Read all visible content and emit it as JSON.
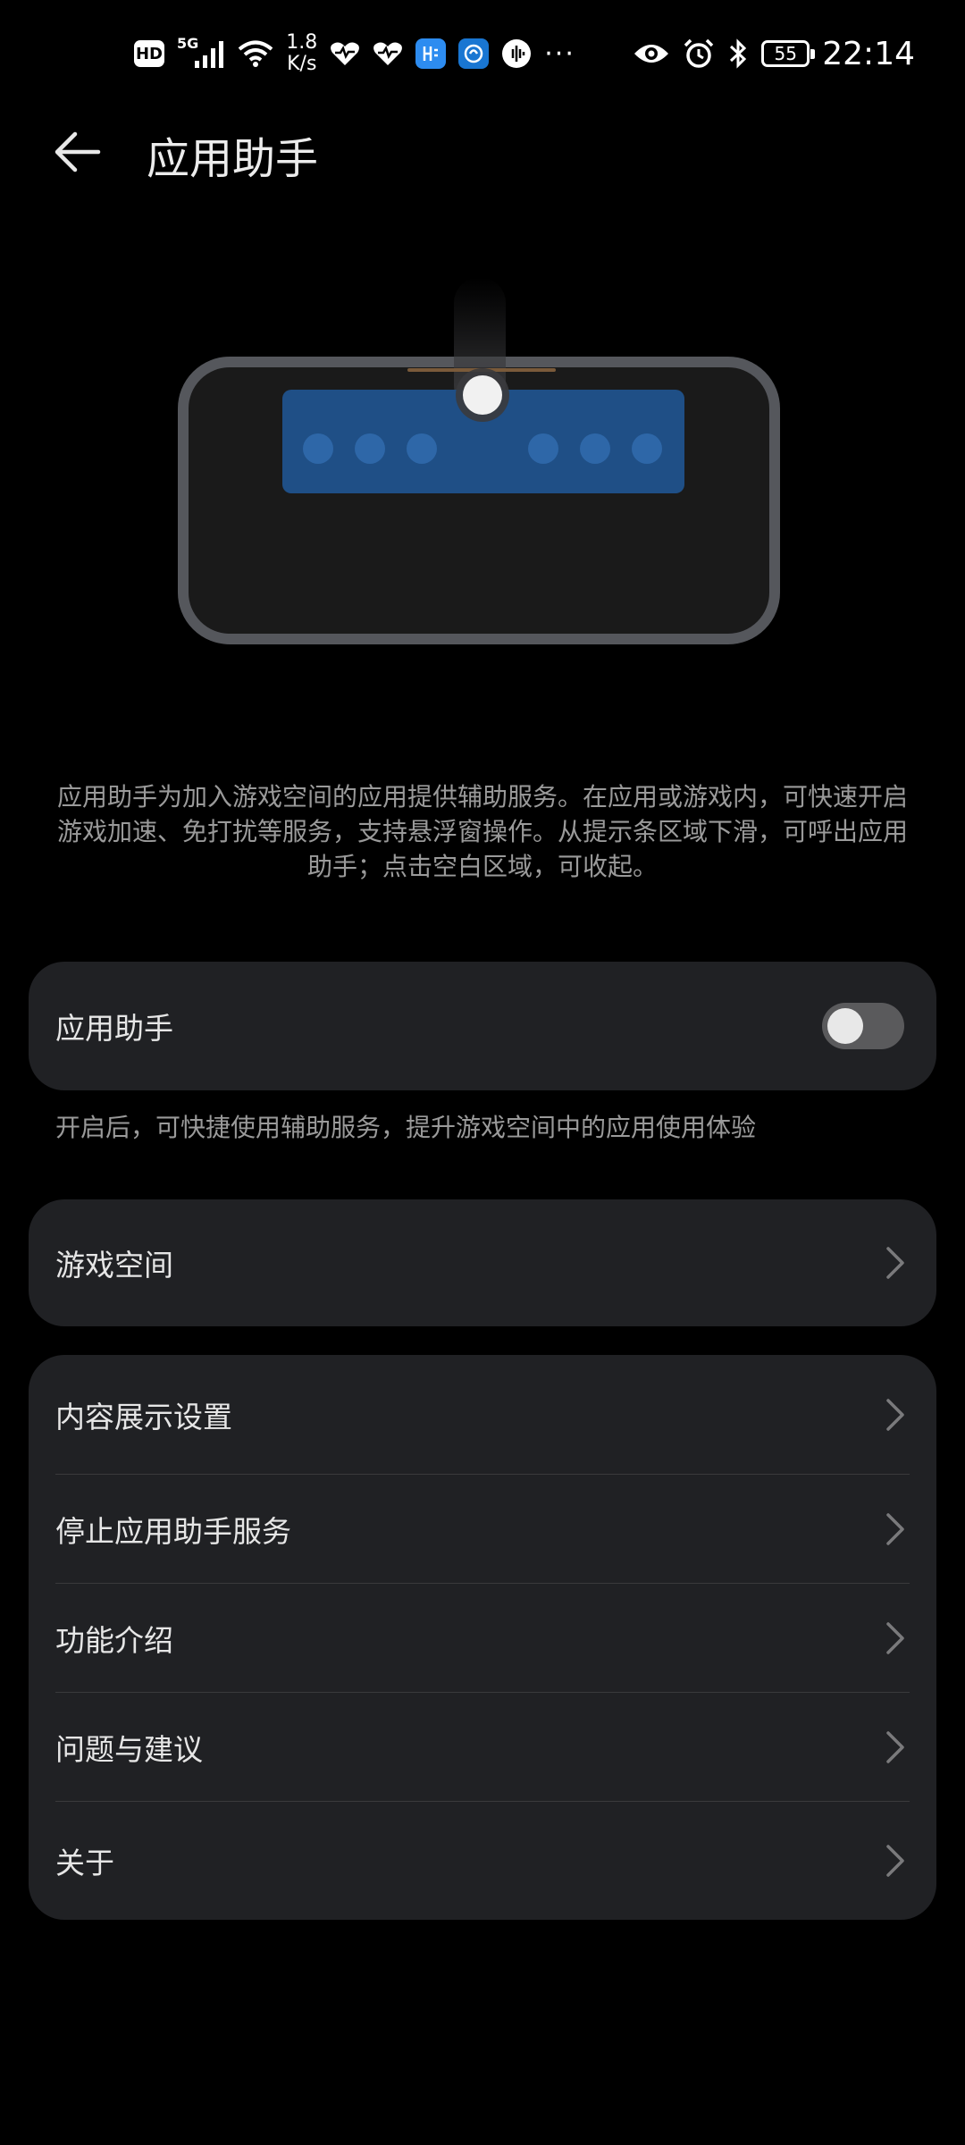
{
  "status_bar": {
    "hd_badge": "HD",
    "network": "5G",
    "speed_value": "1.8",
    "speed_unit": "K/s",
    "battery_level": "55",
    "time": "22:14",
    "icons": [
      "hd-icon",
      "signal-icon",
      "wifi-icon",
      "heart-health-icon",
      "heart-health-icon",
      "app-notification-icon",
      "app-notification-icon",
      "voice-icon",
      "more-dots-icon",
      "eye-comfort-icon",
      "alarm-icon",
      "bluetooth-icon",
      "battery-icon"
    ]
  },
  "header": {
    "title": "应用助手",
    "back_icon": "back-arrow-icon"
  },
  "description": "应用助手为加入游戏空间的应用提供辅助服务。在应用或游戏内，可快速开启游戏加速、免打扰等服务，支持悬浮窗操作。从提示条区域下滑，可呼出应用助手；点击空白区域，可收起。",
  "toggle_card": {
    "label": "应用助手",
    "enabled": false,
    "hint": "开启后，可快捷使用辅助服务，提升游戏空间中的应用使用体验"
  },
  "game_space": {
    "label": "游戏空间"
  },
  "menu": {
    "items": [
      {
        "label": "内容展示设置"
      },
      {
        "label": "停止应用助手服务"
      },
      {
        "label": "功能介绍"
      },
      {
        "label": "问题与建议"
      },
      {
        "label": "关于"
      }
    ]
  },
  "colors": {
    "background": "#000000",
    "card": "#202124",
    "text_primary": "#e6e6e6",
    "text_secondary": "#9a9a9a",
    "illustration_panel": "#1f4f86"
  }
}
